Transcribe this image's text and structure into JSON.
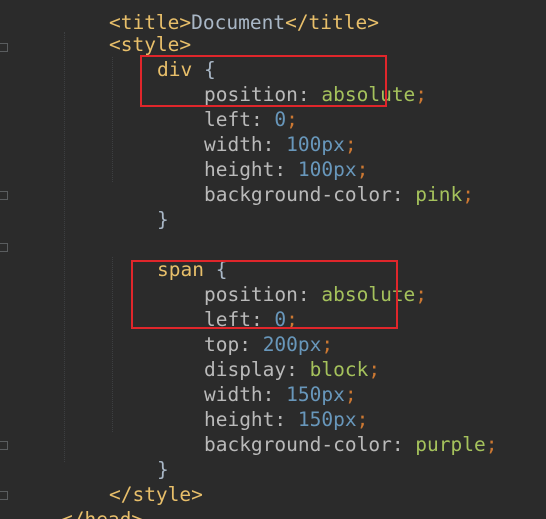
{
  "lines": {
    "l0": {
      "open": "<title>",
      "text": "Document",
      "close": "</title>"
    },
    "l1": {
      "tag": "<style>"
    },
    "l2": {
      "selector": "div",
      "brace": "{"
    },
    "l3": {
      "prop": "position",
      "colon": ": ",
      "value": "absolute",
      "semi": ";"
    },
    "l4": {
      "prop": "left",
      "colon": ": ",
      "value": "0",
      "semi": ";"
    },
    "l5": {
      "prop": "width",
      "colon": ": ",
      "value": "100",
      "unit": "px",
      "semi": ";"
    },
    "l6": {
      "prop": "height",
      "colon": ": ",
      "value": "100",
      "unit": "px",
      "semi": ";"
    },
    "l7": {
      "prop": "background-color",
      "colon": ": ",
      "value": "pink",
      "semi": ";"
    },
    "l8": {
      "brace": "}"
    },
    "l10": {
      "selector": "span",
      "brace": "{"
    },
    "l11": {
      "prop": "position",
      "colon": ": ",
      "value": "absolute",
      "semi": ";"
    },
    "l12": {
      "prop": "left",
      "colon": ": ",
      "value": "0",
      "semi": ";"
    },
    "l13": {
      "prop": "top",
      "colon": ": ",
      "value": "200",
      "unit": "px",
      "semi": ";"
    },
    "l14": {
      "prop": "display",
      "colon": ": ",
      "value": "block",
      "semi": ";"
    },
    "l15": {
      "prop": "width",
      "colon": ": ",
      "value": "150",
      "unit": "px",
      "semi": ";"
    },
    "l16": {
      "prop": "height",
      "colon": ": ",
      "value": "150",
      "unit": "px",
      "semi": ";"
    },
    "l17": {
      "prop": "background-color",
      "colon": ": ",
      "value": "purple",
      "semi": ";"
    },
    "l18": {
      "brace": "}"
    },
    "l19": {
      "tag": "</style>"
    },
    "l20": {
      "tag": "</head>"
    }
  },
  "colors": {
    "background": "#2b2b2b",
    "tag": "#e8bf6a",
    "keyword_value": "#a5c25c",
    "number": "#6897bb",
    "punctuation": "#cc7832",
    "highlight_box": "#e0262b"
  }
}
